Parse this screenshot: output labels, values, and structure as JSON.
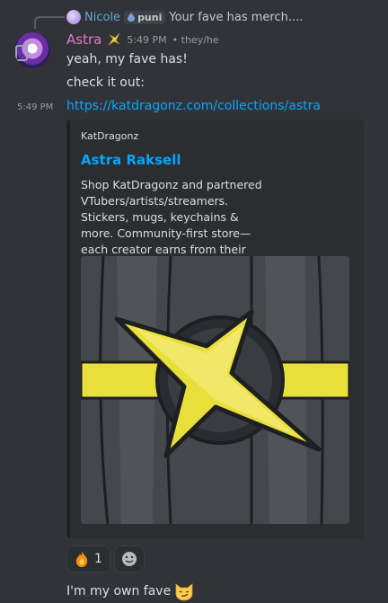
{
  "reply": {
    "author": "Nicole",
    "tag": "puni",
    "text": "Your fave has merch...."
  },
  "message": {
    "author": "Astra",
    "badge_icon": "sparkle-star",
    "timestamp": "5:49 PM",
    "pronouns": "• they/he",
    "lines": [
      "yeah, my fave has!",
      "check it out:"
    ],
    "hover_time": "5:49 PM",
    "link": "https://katdragonz.com/collections/astra"
  },
  "embed": {
    "provider": "KatDragonz",
    "title": "Astra Raksell",
    "description": "Shop KatDragonz and partnered VTubers/artists/streamers. Stickers, mugs, keychains & more. Community-first store—each creator earns from their collection.",
    "image_alt": "yellow star emblem on dark striped background"
  },
  "reactions": [
    {
      "emoji": "fire",
      "count": "1"
    }
  ],
  "followup": {
    "text": "I'm my own fave",
    "emoji": "smirking-cat"
  },
  "colors": {
    "background": "#323339",
    "author": "#e07ac9",
    "link": "#00a8fc",
    "embed_bg": "#2b2d31",
    "star": "#e9df3b"
  }
}
